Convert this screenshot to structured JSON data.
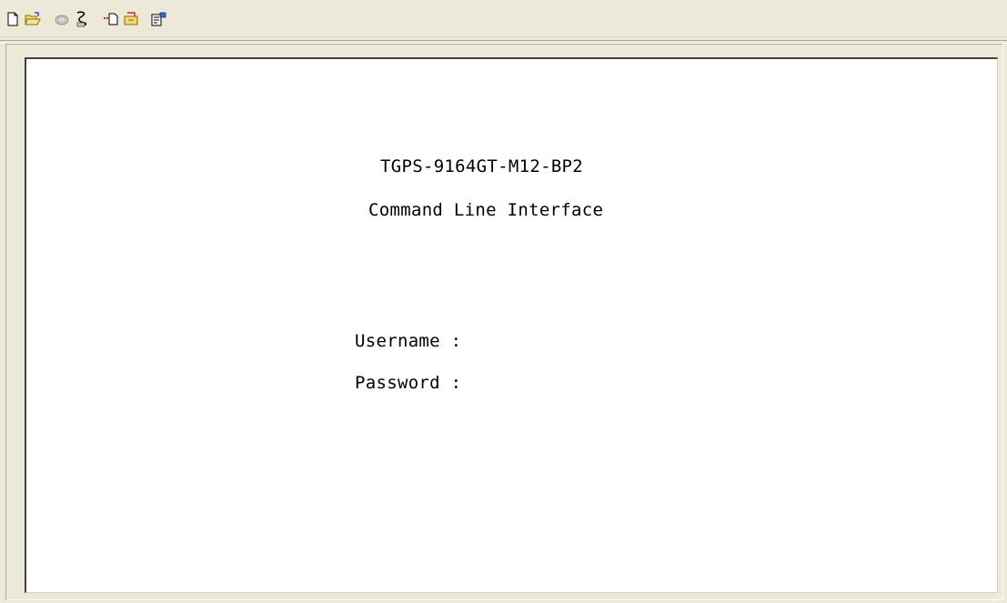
{
  "toolbar": {
    "buttons": [
      {
        "name": "new-document-icon"
      },
      {
        "name": "open-folder-icon"
      },
      {
        "name": "connect-icon"
      },
      {
        "name": "disconnect-icon"
      },
      {
        "name": "send-file-icon"
      },
      {
        "name": "receive-file-icon"
      },
      {
        "name": "properties-icon"
      }
    ]
  },
  "terminal": {
    "device_name": "TGPS-9164GT-M12-BP2",
    "interface_title": "Command Line Interface",
    "username_label": "Username :",
    "password_label": "Password :"
  },
  "colors": {
    "chrome": "#ece9d8",
    "terminal_bg": "#ffffff",
    "text": "#000000"
  }
}
